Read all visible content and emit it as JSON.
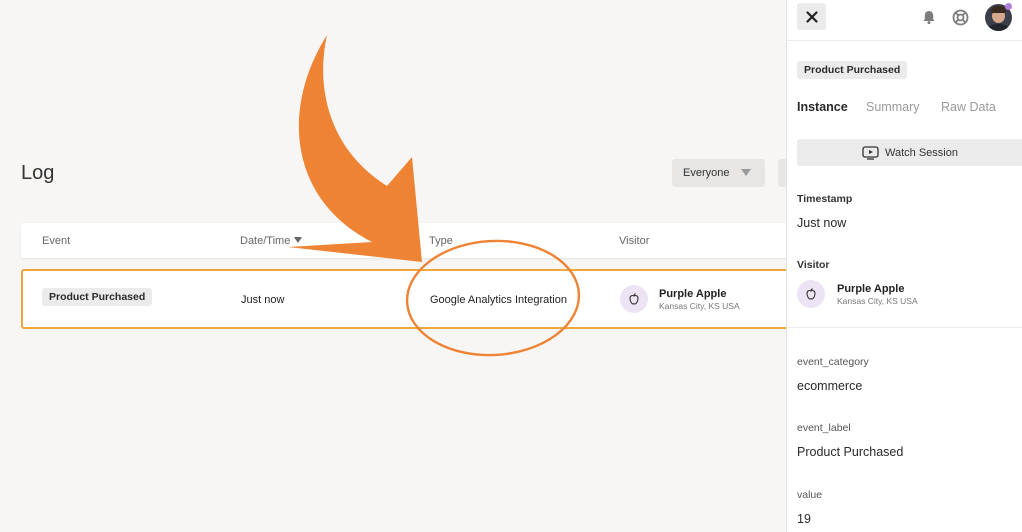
{
  "page": {
    "title": "Log"
  },
  "filters": {
    "audience_label": "Everyone"
  },
  "table": {
    "columns": [
      "Event",
      "Date/Time",
      "Type",
      "Visitor"
    ],
    "rows": [
      {
        "event": "Product Purchased",
        "datetime": "Just now",
        "type": "Google Analytics Integration",
        "visitor_name": "Purple Apple",
        "visitor_location": "Kansas City, KS USA"
      }
    ]
  },
  "panel": {
    "event_badge": "Product Purchased",
    "tabs": [
      "Instance",
      "Summary",
      "Raw Data"
    ],
    "active_tab": "Instance",
    "watch_session_label": "Watch Session",
    "timestamp_label": "Timestamp",
    "timestamp_value": "Just now",
    "visitor_label": "Visitor",
    "visitor_name": "Purple Apple",
    "visitor_location": "Kansas City, KS USA",
    "fields": [
      {
        "key": "event_category",
        "value": "ecommerce"
      },
      {
        "key": "event_label",
        "value": "Product Purchased"
      },
      {
        "key": "value",
        "value": "19"
      }
    ]
  },
  "icons": {
    "close": "close-icon",
    "notifications": "bell-icon",
    "help": "lifebuoy-icon",
    "user": "avatar",
    "visitor": "apple-icon",
    "watch": "play-screen-icon"
  },
  "colors": {
    "highlight_border": "#efa63b",
    "annotation": "#ee8334",
    "avatar_bg": "#ece4f4",
    "status_dot": "#b07ed6"
  }
}
